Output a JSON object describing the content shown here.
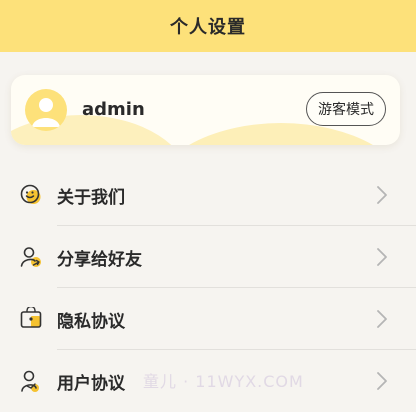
{
  "header": {
    "title": "个人设置",
    "background": "#fde17a"
  },
  "profile": {
    "username": "admin",
    "avatar_icon": "user-avatar-icon",
    "mode_button_label": "游客模式"
  },
  "menu": {
    "items": [
      {
        "label": "关于我们",
        "icon": "smiley-chat-icon"
      },
      {
        "label": "分享给好友",
        "icon": "share-friend-icon"
      },
      {
        "label": "隐私协议",
        "icon": "privacy-lock-icon"
      },
      {
        "label": "用户协议",
        "icon": "user-agreement-icon"
      }
    ],
    "chevron_icon": "chevron-right-icon"
  },
  "watermark": {
    "text": "童儿 · 11WYX.COM"
  },
  "colors": {
    "accent": "#fde17a",
    "accent_dark": "#f5c230",
    "background": "#f6f4f0",
    "card": "#fffdf5"
  }
}
